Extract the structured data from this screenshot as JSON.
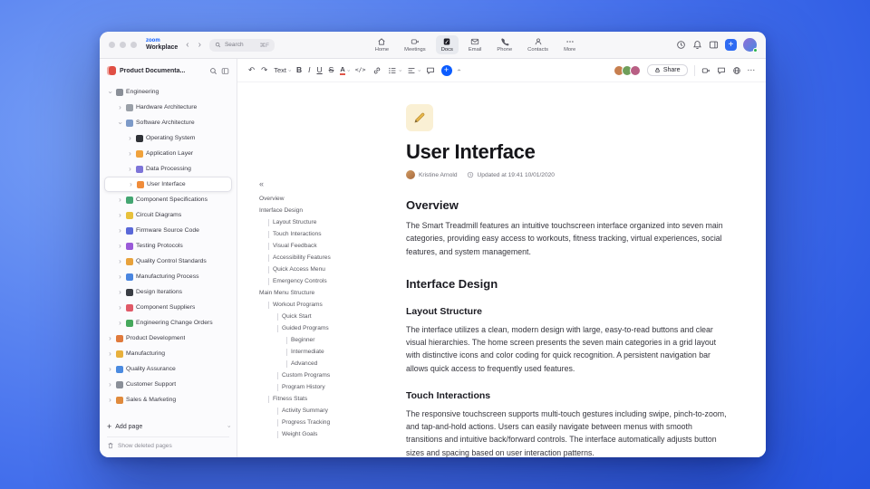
{
  "icons": {
    "back": "‹",
    "forward": "›",
    "chevron": "›",
    "collapse_outline": "«",
    "undo": "↶",
    "redo": "↷",
    "plus": "+",
    "ellipsis": "⋯"
  },
  "window": {
    "logo": {
      "line1": "zoom",
      "line2": "Workplace"
    },
    "search": {
      "placeholder": "Search",
      "shortcut": "⌘F"
    },
    "tabs": [
      {
        "label": "Home",
        "icon": "home",
        "active": false
      },
      {
        "label": "Meetings",
        "icon": "video",
        "active": false
      },
      {
        "label": "Docs",
        "icon": "docs",
        "active": true
      },
      {
        "label": "Email",
        "icon": "email",
        "active": false
      },
      {
        "label": "Phone",
        "icon": "phone",
        "active": false
      },
      {
        "label": "Contacts",
        "icon": "contacts",
        "active": false
      },
      {
        "label": "More",
        "icon": "more",
        "active": false
      }
    ]
  },
  "sidebar": {
    "title": "Product Documenta...",
    "add_page": "Add page",
    "show_deleted": "Show deleted pages",
    "tree": [
      {
        "label": "Engineering",
        "level": 0,
        "chevron": "down",
        "color": "#8a8f98",
        "selected": false
      },
      {
        "label": "Hardware Architecture",
        "level": 1,
        "chevron": "right",
        "color": "#9aa0a8",
        "selected": false
      },
      {
        "label": "Software Architecture",
        "level": 1,
        "chevron": "down",
        "color": "#7d9ac8",
        "selected": false
      },
      {
        "label": "Operating System",
        "level": 2,
        "chevron": "right",
        "color": "#2f3237",
        "selected": false
      },
      {
        "label": "Application Layer",
        "level": 2,
        "chevron": "right",
        "color": "#f0a23c",
        "selected": false
      },
      {
        "label": "Data Processing",
        "level": 2,
        "chevron": "right",
        "color": "#7d74d8",
        "selected": false
      },
      {
        "label": "User Interface",
        "level": 2,
        "chevron": "right",
        "color": "#f08c3a",
        "selected": true
      },
      {
        "label": "Component Specifications",
        "level": 1,
        "chevron": "right",
        "color": "#44a672",
        "selected": false
      },
      {
        "label": "Circuit Diagrams",
        "level": 1,
        "chevron": "right",
        "color": "#e8c13c",
        "selected": false
      },
      {
        "label": "Firmware Source Code",
        "level": 1,
        "chevron": "right",
        "color": "#5a68d8",
        "selected": false
      },
      {
        "label": "Testing Protocols",
        "level": 1,
        "chevron": "right",
        "color": "#9a5ad8",
        "selected": false
      },
      {
        "label": "Quality Control Standards",
        "level": 1,
        "chevron": "right",
        "color": "#e8a23c",
        "selected": false
      },
      {
        "label": "Manufacturing Process",
        "level": 1,
        "chevron": "right",
        "color": "#4a86e0",
        "selected": false
      },
      {
        "label": "Design Iterations",
        "level": 1,
        "chevron": "right",
        "color": "#3a3d44",
        "selected": false
      },
      {
        "label": "Component Suppliers",
        "level": 1,
        "chevron": "right",
        "color": "#e05a68",
        "selected": false
      },
      {
        "label": "Engineering Change Orders",
        "level": 1,
        "chevron": "right",
        "color": "#46a85c",
        "selected": false
      },
      {
        "label": "Product Development",
        "level": 0,
        "chevron": "right",
        "color": "#e07a3c",
        "selected": false
      },
      {
        "label": "Manufacturing",
        "level": 0,
        "chevron": "right",
        "color": "#e8b03c",
        "selected": false
      },
      {
        "label": "Quality Assurance",
        "level": 0,
        "chevron": "right",
        "color": "#4a8ae0",
        "selected": false
      },
      {
        "label": "Customer Support",
        "level": 0,
        "chevron": "right",
        "color": "#8a8f98",
        "selected": false
      },
      {
        "label": "Sales & Marketing",
        "level": 0,
        "chevron": "right",
        "color": "#e08a3c",
        "selected": false
      }
    ]
  },
  "toolbar": {
    "text_style": "Text",
    "bold": "B",
    "italic": "I",
    "underline": "U",
    "strike": "S",
    "color": "A",
    "code": "</>",
    "share_label": "Share",
    "avatars": [
      "#c77f4f",
      "#6f9e5a",
      "#b85f84"
    ]
  },
  "outline": {
    "items": [
      {
        "label": "Overview",
        "level": 0
      },
      {
        "label": "Interface Design",
        "level": 0
      },
      {
        "label": "Layout Structure",
        "level": 1
      },
      {
        "label": "Touch Interactions",
        "level": 1
      },
      {
        "label": "Visual Feedback",
        "level": 1
      },
      {
        "label": "Accessibility Features",
        "level": 1
      },
      {
        "label": "Quick Access Menu",
        "level": 1
      },
      {
        "label": "Emergency Controls",
        "level": 1
      },
      {
        "label": "Main Menu Structure",
        "level": 0
      },
      {
        "label": "Workout Programs",
        "level": 1
      },
      {
        "label": "Quick Start",
        "level": 2
      },
      {
        "label": "Guided Programs",
        "level": 2
      },
      {
        "label": "Beginner",
        "level": 3
      },
      {
        "label": "Intermediate",
        "level": 3
      },
      {
        "label": "Advanced",
        "level": 3
      },
      {
        "label": "Custom Programs",
        "level": 2
      },
      {
        "label": "Program History",
        "level": 2
      },
      {
        "label": "Fitness Stats",
        "level": 1
      },
      {
        "label": "Activity Summary",
        "level": 2
      },
      {
        "label": "Progress Tracking",
        "level": 2
      },
      {
        "label": "Weight Goals",
        "level": 2
      }
    ]
  },
  "doc": {
    "icon": "pencil-icon",
    "title": "User Interface",
    "author": "Kristine Arnold",
    "updated": "Updated at 19:41 10/01/2020",
    "sections": [
      {
        "type": "h2",
        "text": "Overview"
      },
      {
        "type": "p",
        "text": "The Smart Treadmill features an intuitive touchscreen interface organized into seven main categories, providing easy access to workouts, fitness tracking, virtual experiences, social features, and system management."
      },
      {
        "type": "h2",
        "text": "Interface Design"
      },
      {
        "type": "h3",
        "text": "Layout Structure"
      },
      {
        "type": "p",
        "text": "The interface utilizes a clean, modern design with large, easy-to-read buttons and clear visual hierarchies. The home screen presents the seven main categories in a grid layout with distinctive icons and color coding for quick recognition. A persistent navigation bar allows quick access to frequently used features."
      },
      {
        "type": "h3",
        "text": "Touch Interactions"
      },
      {
        "type": "p",
        "text": "The responsive touchscreen supports multi-touch gestures including swipe, pinch-to-zoom, and tap-and-hold actions. Users can easily navigate between menus with smooth transitions and intuitive back/forward controls. The interface automatically adjusts button sizes and spacing based on user interaction patterns."
      }
    ]
  },
  "accent_colors": {
    "zoom_blue": "#0b5cff",
    "presence_green": "#2bb24c",
    "workspace_red": "#e04f44"
  }
}
